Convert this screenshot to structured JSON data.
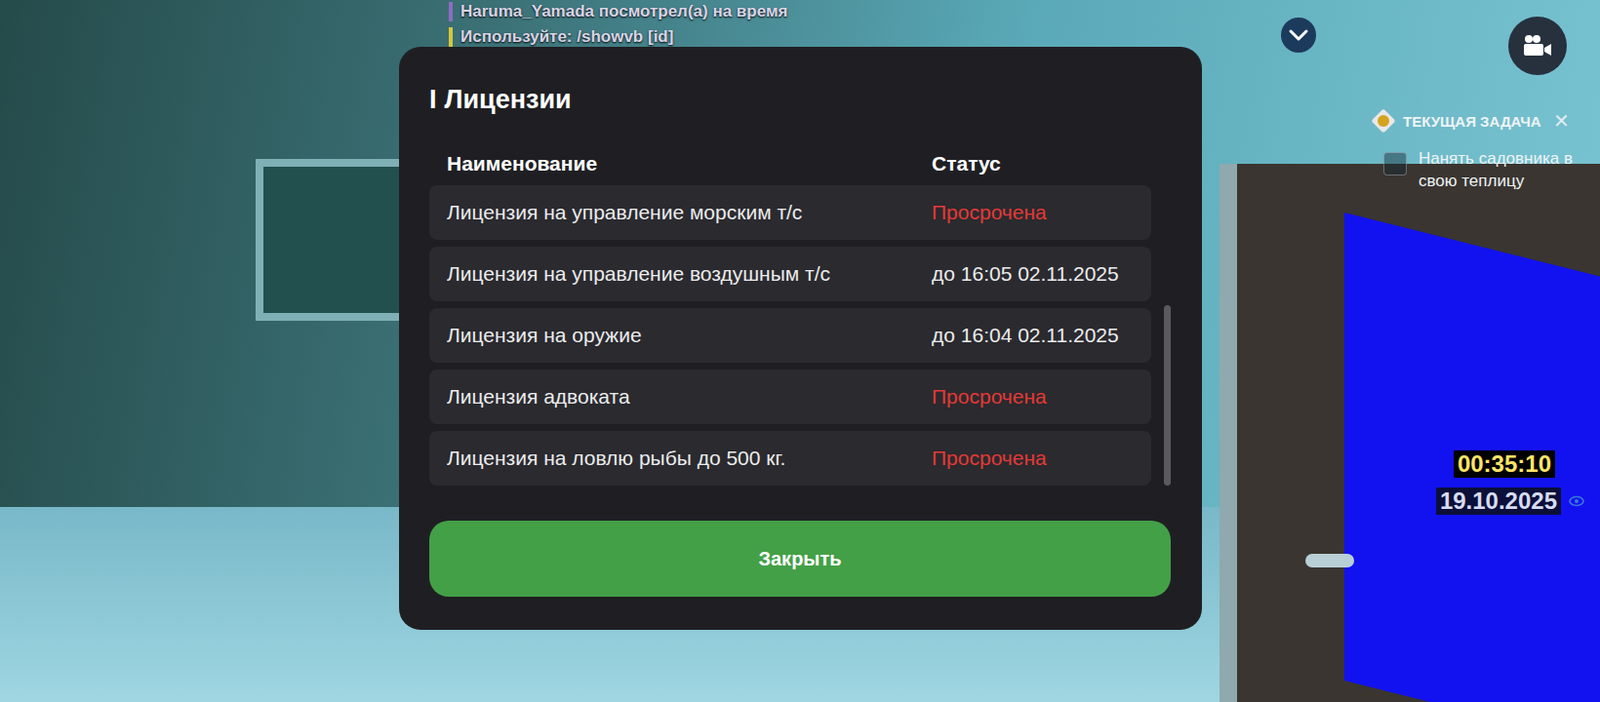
{
  "chat": [
    {
      "text": "Haruma_Yamada посмотрел(а) на время",
      "color": "#8e6cc4"
    },
    {
      "text": "Используйте: /showvb [id]",
      "color": "#d6c63c"
    }
  ],
  "dialog": {
    "title_mark": "I",
    "title": "Лицензии",
    "columns": [
      "Наименование",
      "Статус"
    ],
    "rows": [
      {
        "name": "Лицензия на управление морским т/с",
        "status": "Просрочена",
        "expired": true
      },
      {
        "name": "Лицензия на управление воздушным т/с",
        "status": "до 16:05 02.11.2025",
        "expired": false
      },
      {
        "name": "Лицензия на оружие",
        "status": "до 16:04 02.11.2025",
        "expired": false
      },
      {
        "name": "Лицензия адвоката",
        "status": "Просрочена",
        "expired": true
      },
      {
        "name": "Лицензия на ловлю рыбы до 500 кг.",
        "status": "Просрочена",
        "expired": true
      }
    ],
    "scrollbar": {
      "level": 0.6
    },
    "close_button": "Закрыть"
  },
  "hud": {
    "task": {
      "label": "ТЕКУЩАЯ ЗАДАЧА",
      "close": "✕",
      "items": [
        {
          "text": "Нанять садовника в свою теплицу",
          "checked": false
        }
      ]
    },
    "clock": {
      "time": "00:35:10",
      "date": "19.10.2025"
    }
  }
}
